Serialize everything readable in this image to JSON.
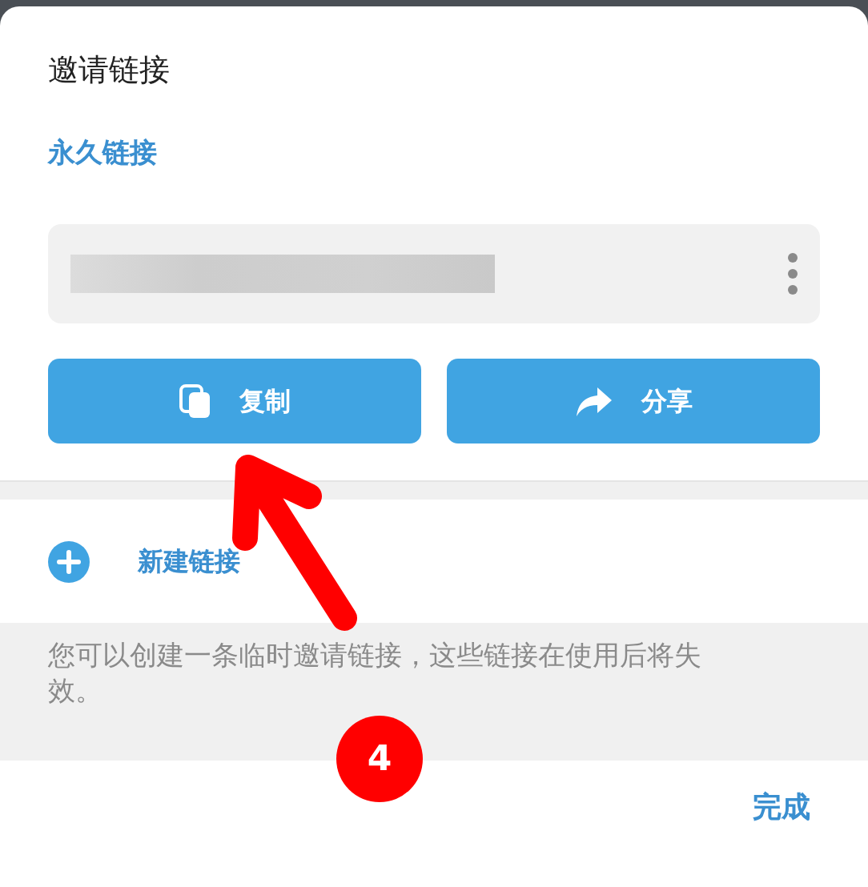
{
  "dialog": {
    "title": "邀请链接"
  },
  "permanent_link": {
    "heading": "永久链接",
    "link": {
      "kind": "blurred"
    }
  },
  "buttons": [
    {
      "label": "复制",
      "kind": "copy"
    },
    {
      "label": "分享",
      "kind": "share"
    }
  ],
  "new_link": {
    "label": "新建链接"
  },
  "hint": "您可以创建一条临时邀请链接，这些链接在使用后将失效。",
  "footer": {
    "done": "完成"
  },
  "annotation": {
    "step": "4"
  }
}
